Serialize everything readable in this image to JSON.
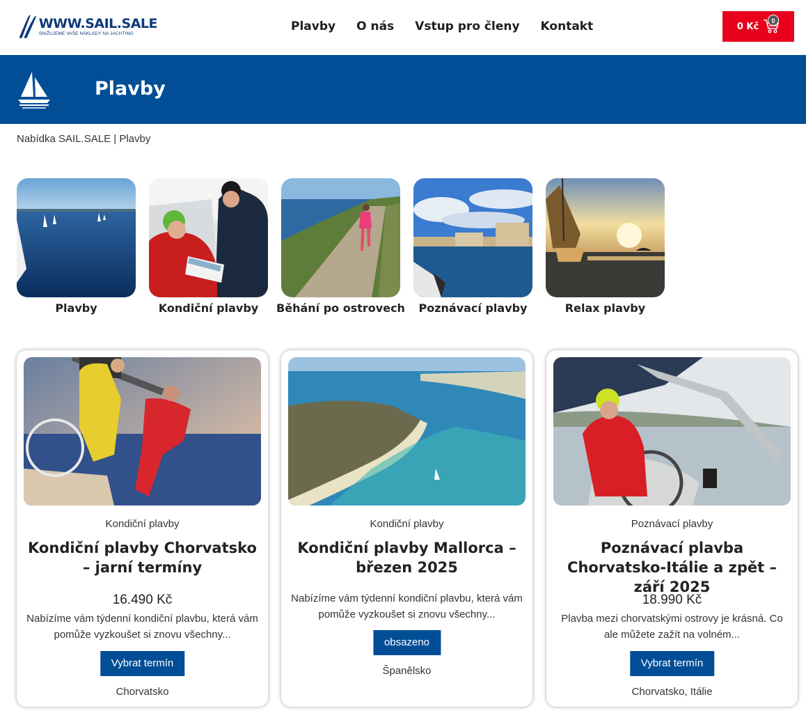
{
  "brand": {
    "title": "WWW.SAIL.SALE",
    "tagline": "SNIŽUJEME VAŠE NÁKLADY NA JACHTING",
    "color": "#0d3b7a"
  },
  "nav": {
    "items": [
      "Plavby",
      "O nás",
      "Vstup pro členy",
      "Kontakt"
    ]
  },
  "cart": {
    "price": "0 Kč",
    "count": "0",
    "color": "#e8001d"
  },
  "banner": {
    "title": "Plavby",
    "color": "#024e96"
  },
  "breadcrumb": {
    "home": "Nabídka SAIL.SALE",
    "separator": " | ",
    "current": "Plavby"
  },
  "categories": [
    {
      "label": "Plavby"
    },
    {
      "label": "Kondiční plavby"
    },
    {
      "label": "Běhání po ostrovech"
    },
    {
      "label": "Poznávací plavby"
    },
    {
      "label": "Relax plavby"
    }
  ],
  "products": [
    {
      "category": "Kondiční plavby",
      "title": "Kondiční plavby Chorvatsko – jarní termíny",
      "price": "16.490 Kč",
      "description": "Nabízíme vám týdenní kondiční plavbu, která vám pomůže vyzkoušet si znovu všechny...",
      "button": "Vybrat termín",
      "location": "Chorvatsko"
    },
    {
      "category": "Kondiční plavby",
      "title": "Kondiční plavby Mallorca – březen 2025",
      "price": "",
      "description": "Nabízíme vám týdenní kondiční plavbu, která vám pomůže vyzkoušet si znovu všechny...",
      "button": "obsazeno",
      "location": "Španělsko"
    },
    {
      "category": "Poznávací plavby",
      "title": "Poznávací plavba Chorvatsko-Itálie a zpět – září 2025",
      "price": "18.990 Kč",
      "description": "Plavba mezi chorvatskými ostrovy je krásná. Co ale můžete zažít na volném...",
      "button": "Vybrat termín",
      "location": "Chorvatsko, Itálie"
    }
  ]
}
